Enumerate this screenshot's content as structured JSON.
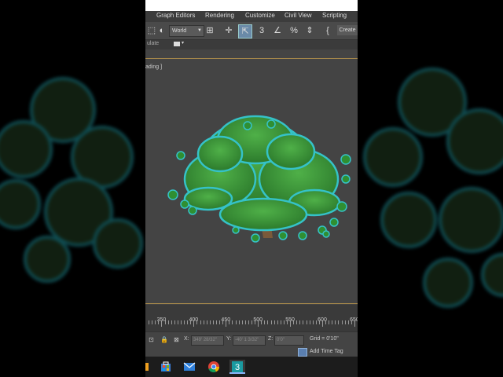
{
  "menu": {
    "items": [
      "Graph Editors",
      "Rendering",
      "Customize",
      "Civil View",
      "Scripting"
    ]
  },
  "toolbar": {
    "coord_system": "World",
    "create_label": "Create",
    "icons": [
      "snap-toggle-icon",
      "angle-snap-icon",
      "percent-snap-icon",
      "spinner-snap-icon",
      "edit-named-selection-icon"
    ]
  },
  "ribbon": {
    "label": "ulate"
  },
  "viewport": {
    "label": "ading ]"
  },
  "timeline": {
    "ticks": [
      "350",
      "400",
      "450",
      "500",
      "550",
      "600",
      "650"
    ]
  },
  "status": {
    "x_label": "X:",
    "x_value": "349' 28/32\"",
    "y_label": "Y:",
    "y_value": "-40' 1 3/32\"",
    "z_label": "Z:",
    "z_value": "0'0\"",
    "grid": "Grid = 0'10\"",
    "add_time_tag": "Add Time Tag"
  },
  "colors": {
    "foliage": "#3f9a3c",
    "selection_outline": "#35c2c8",
    "viewport_bg": "#444444",
    "timeline_accent": "#a4864a"
  }
}
